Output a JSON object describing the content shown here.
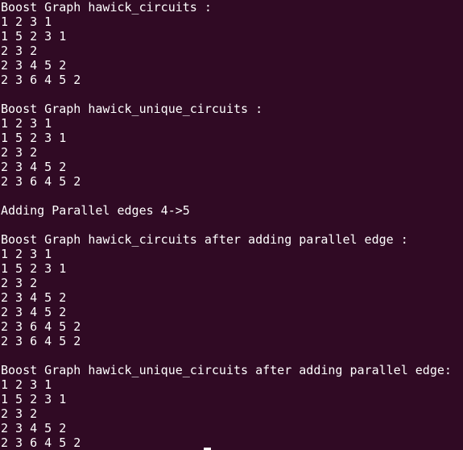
{
  "terminal": {
    "lines": [
      "Boost Graph hawick_circuits :",
      "1 2 3 1",
      "1 5 2 3 1",
      "2 3 2",
      "2 3 4 5 2",
      "2 3 6 4 5 2",
      "",
      "Boost Graph hawick_unique_circuits :",
      "1 2 3 1",
      "1 5 2 3 1",
      "2 3 2",
      "2 3 4 5 2",
      "2 3 6 4 5 2",
      "",
      "Adding Parallel edges 4->5",
      "",
      "Boost Graph hawick_circuits after adding parallel edge :",
      "1 2 3 1",
      "1 5 2 3 1",
      "2 3 2",
      "2 3 4 5 2",
      "2 3 4 5 2",
      "2 3 6 4 5 2",
      "2 3 6 4 5 2",
      "",
      "Boost Graph hawick_unique_circuits after adding parallel edge:",
      "1 2 3 1",
      "1 5 2 3 1",
      "2 3 2",
      "2 3 4 5 2",
      "2 3 6 4 5 2"
    ],
    "colors": {
      "background": "#300a24",
      "foreground": "#ffffff"
    }
  }
}
